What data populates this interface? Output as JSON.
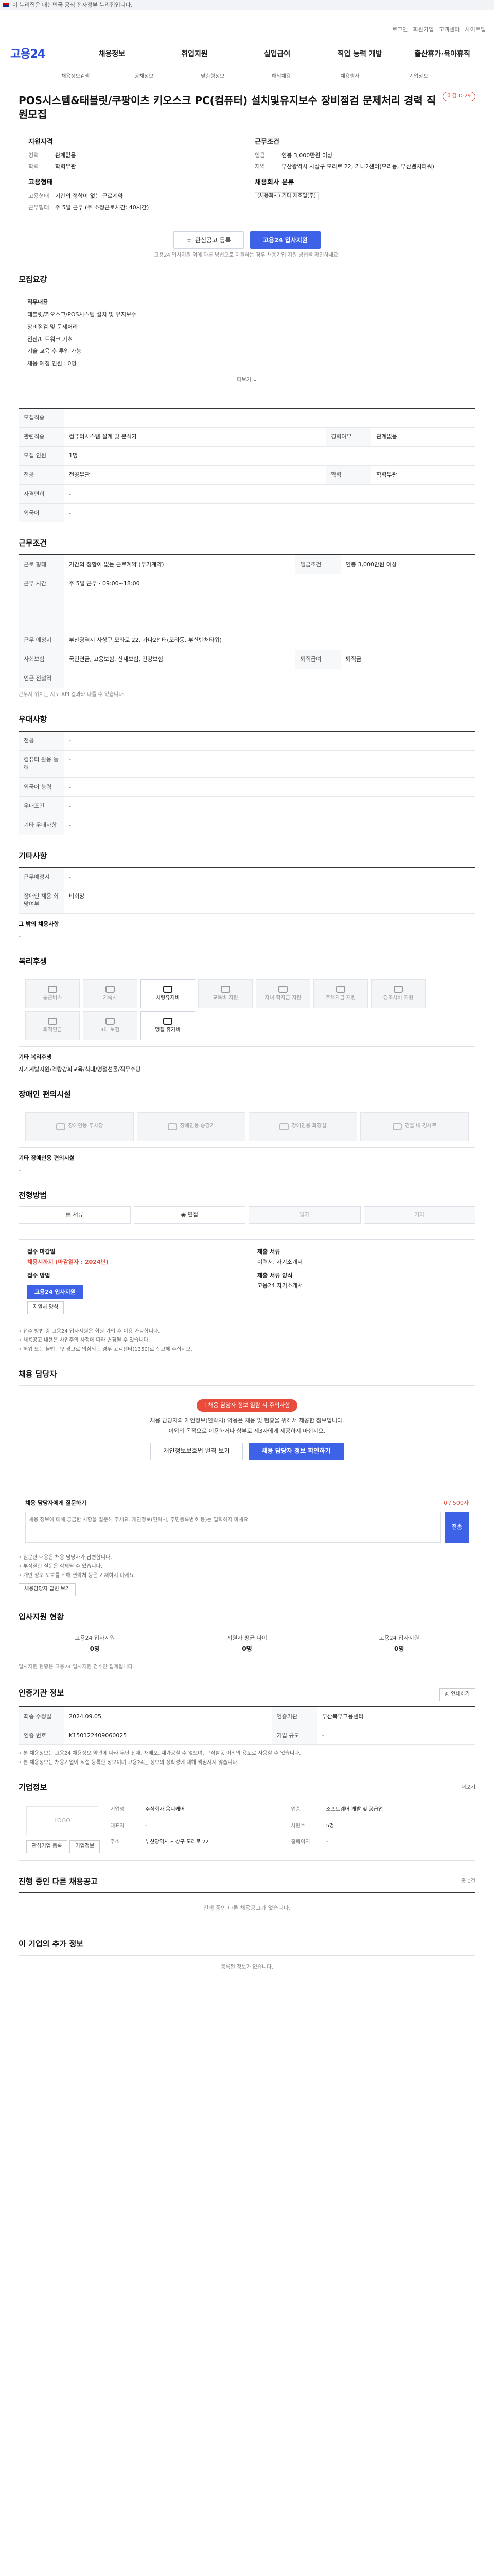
{
  "topbar": {
    "notice": "이 누리집은 대한민국 공식 전자정부 누리집입니다.",
    "link": "",
    "right": ""
  },
  "util": [
    "로그인",
    "회원가입",
    "고객센터",
    "사이트맵"
  ],
  "logo": {
    "brand": "고용24"
  },
  "nav": [
    "채용정보",
    "취업지원",
    "실업급여",
    "직업 능력 개발",
    "출산휴가·육아휴직"
  ],
  "subnav": [
    "채용정보검색",
    "공채정보",
    "맞춤형정보",
    "해외채용",
    "채용행사",
    "기업정보"
  ],
  "header": {
    "company": "",
    "title": "POS시스템&태블릿/쿠팡이츠 키오스크 PC(컴퓨터) 설치및유지보수 장비점검 문제처리 경력 직원모집",
    "badge": "마감 D-29"
  },
  "summary": {
    "left_h": "지원자격",
    "left": [
      {
        "k": "경력",
        "v": "관계없음"
      },
      {
        "k": "학력",
        "v": "학력무관"
      }
    ],
    "left2_h": "고용형태",
    "left2": [
      {
        "k": "고용형태",
        "v": "기간의 정함이 없는 근로계약"
      },
      {
        "k": "근무형태",
        "v": "주 5일 근무 (주 소정근로시간: 40시간)"
      }
    ],
    "right_h": "근무조건",
    "right": [
      {
        "k": "임금",
        "v": "연봉 3,000만원 이상"
      },
      {
        "k": "지역",
        "v": "부산광역시 사상구 모라로 22, 가나2센터(모라동, 부산벤처타워)"
      }
    ],
    "right2_h": "채용회사 분류",
    "right2": [
      {
        "k": "",
        "v": "(채용회사) 기타 제조업(주)"
      }
    ]
  },
  "actions": {
    "save": "관심공고 등록",
    "apply": "고용24 입사지원"
  },
  "note": "고용24 입사지원 외에 다른 방법으로 지원하는 경우 채용기업 지원 방법을 확인하세요.",
  "recruit": {
    "h": "모집요강",
    "lines": [
      "직무내용",
      "태블릿/키오스크/POS시스템 설치 및 유지보수",
      "장비점검 및 문제처리",
      "전산/네트워크 기초",
      "기술 교육 후 투입 가능",
      "채용 예정 인원 : 0명"
    ],
    "more": "더보기"
  },
  "reqtable": {
    "rows": [
      {
        "k": "모집직종",
        "v": "",
        "k2": "",
        "v2": ""
      },
      {
        "k": "관련직종",
        "v": "컴퓨터시스템 설계 및 분석가",
        "k2": "경력여부",
        "v2": "관계없음"
      },
      {
        "k": "모집 인원",
        "v": "1명",
        "k2": "",
        "v2": ""
      },
      {
        "k": "전공",
        "v": "전공무관",
        "k2": "학력",
        "v2": "학력무관"
      },
      {
        "k": "자격면허",
        "v": "-",
        "k2": "",
        "v2": ""
      },
      {
        "k": "외국어",
        "v": "-",
        "k2": "",
        "v2": ""
      }
    ]
  },
  "work": {
    "h": "근무조건",
    "rows": [
      {
        "k": "근로 형태",
        "v": "기간의 정함이 없는 근로계약 (무기계약)",
        "k2": "임금조건",
        "v2": "연봉 3,000만원 이상"
      },
      {
        "k": "근무 시간",
        "v": "주 5일 근무 · 09:00~18:00",
        "k2": "",
        "v2": ""
      },
      {
        "k": "근무 예정지",
        "v": "부산광역시 사상구 모라로 22, 가나2센터(모라동, 부산벤처타워)",
        "k2": "",
        "v2": ""
      },
      {
        "k": "사회보험",
        "v": "국민연금, 고용보험, 산재보험, 건강보험",
        "k2": "퇴직급여",
        "v2": "퇴직금"
      },
      {
        "k": "인근 전철역",
        "v": "",
        "k2": "",
        "v2": ""
      }
    ],
    "tip": "근무지 위치는 지도 API 결과와 다를 수 있습니다."
  },
  "pref": {
    "h": "우대사항",
    "rows": [
      {
        "k": "전공",
        "v": "-"
      },
      {
        "k": "컴퓨터 활용 능력",
        "v": "-"
      },
      {
        "k": "외국어 능력",
        "v": "-"
      },
      {
        "k": "우대조건",
        "v": "-"
      },
      {
        "k": "기타 우대사항",
        "v": "-"
      }
    ]
  },
  "etc": {
    "h": "기타사항",
    "rows": [
      {
        "k": "근무예정시",
        "v": "-"
      },
      {
        "k": "장애인 채용 희망여부",
        "v": "비희망"
      }
    ],
    "extra_h": "그 밖의 채용사항",
    "extra": "-"
  },
  "welfare": {
    "h": "복리후생",
    "items": [
      "통근버스",
      "기숙사",
      "차량유지비",
      "교육비 지원",
      "자녀 학자금 지원",
      "주택자금 지원",
      "경조사비 지원",
      "퇴직연금",
      "4대 보험",
      "명절 휴가비"
    ],
    "active": [
      2,
      9
    ],
    "sub_h": "기타 복리후생",
    "sub": "자기계발지원/역량강화교육/식대/명절선물/직무수당"
  },
  "disab": {
    "h": "장애인 편의시설",
    "items": [
      "장애인용 주차장",
      "장애인용 승강기",
      "장애인용 화장실",
      "건물 내 경사로"
    ],
    "sub_h": "기타 장애인용 편의시설",
    "sub": "-"
  },
  "apply": {
    "h": "전형방법",
    "steps": [
      "서류",
      "면접",
      "필기",
      "기타"
    ],
    "col1": [
      {
        "l": "접수 마감일",
        "v": "채용시까지 (마감일자 : 2024년)"
      },
      {
        "l": "접수 방법",
        "v": "고용24 입사지원"
      }
    ],
    "col2": [
      {
        "l": "제출 서류",
        "v": "이력서, 자기소개서"
      },
      {
        "l": "제출 서류 양식",
        "v": "고용24 자기소개서"
      }
    ],
    "btn": "고용24 입사지원",
    "btn2": "지원서 양식",
    "bullets": [
      "접수 방법 중 고용24 입사지원은 회원 가입 후 이용 가능합니다.",
      "채용공고 내용은 사업주의 사정에 따라 변경될 수 있습니다.",
      "허위 또는 불법 구인광고로 의심되는 경우 고객센터(1350)로 신고해 주십시오."
    ]
  },
  "contact": {
    "h": "채용 담당자",
    "pill": "채용 담당자 정보 열람 시 주의사항",
    "lines": [
      "채용 담당자의 개인정보(연락처) 악용은 채용 및 현황을 위해서 제공한 정보입니다.",
      "이외의 목적으로 이용하거나 함부로 제3자에게 제공하지 마십시오."
    ],
    "btn1": "개인정보보호법 벌칙 보기",
    "btn2": "채용 담당자 정보 확인하기"
  },
  "qa": {
    "h": "채용 담당자에게 질문하기",
    "count": "0 / 500자",
    "placeholder": "채용 정보에 대해 궁금한 사항을 질문해 주세요. 개인정보(연락처, 주민등록번호 등)는 입력하지 마세요.",
    "send": "전송",
    "bullets": [
      "질문한 내용은 채용 담당자가 답변합니다.",
      "부적절한 질문은 삭제될 수 있습니다.",
      "개인 정보 보호를 위해 연락처 등은 기재하지 마세요."
    ],
    "btn": "채용담당자 답변 보기"
  },
  "stats": {
    "h": "입사지원 현황",
    "items": [
      {
        "l": "고용24 입사지원",
        "n": "0명"
      },
      {
        "l": "지원자 평균 나이",
        "n": "0명"
      },
      {
        "l": "고용24 입사지원",
        "n": "0명"
      }
    ],
    "tip": "입사지원 현황은 고용24 입사지원 건수만 집계됩니다."
  },
  "detail": {
    "h": "인증기관 정보",
    "print": "인쇄하기",
    "rows": [
      {
        "k": "최종 수정일",
        "v": "2024.09.05",
        "k2": "인증기관",
        "v2": "부산북부고용센터"
      },
      {
        "k": "인증 번호",
        "v": "K150122409060025",
        "k2": "기업 규모",
        "v2": "-"
      }
    ],
    "bullets": [
      "본 채용정보는 고용24 채용정보 약관에 따라 무단 전재, 재배포, 재가공할 수 없으며, 구직활동 이외의 용도로 사용할 수 없습니다.",
      "본 채용정보는 채용기업이 직접 등록한 정보이며 고용24는 정보의 정확성에 대해 책임지지 않습니다."
    ]
  },
  "company": {
    "h": "기업정보",
    "more": "더보기",
    "logo": "LOGO",
    "btn1": "관심기업 등록",
    "btn2": "기업정보",
    "grid": [
      {
        "k": "기업명",
        "v": "주식회사 옴니케어"
      },
      {
        "k": "업종",
        "v": "소프트웨어 개발 및 공급업"
      },
      {
        "k": "대표자",
        "v": "-"
      },
      {
        "k": "사원수",
        "v": "5명"
      },
      {
        "k": "주소",
        "v": "부산광역시 사상구 모라로 22"
      },
      {
        "k": "홈페이지",
        "v": "-"
      }
    ]
  },
  "others": {
    "h": "진행 중인 다른 채용공고",
    "right": "총 0건",
    "empty": "진행 중인 다른 채용공고가 없습니다."
  },
  "others2": {
    "h": "이 기업의 추가 정보",
    "right": "",
    "empty": "등록된 정보가 없습니다."
  }
}
